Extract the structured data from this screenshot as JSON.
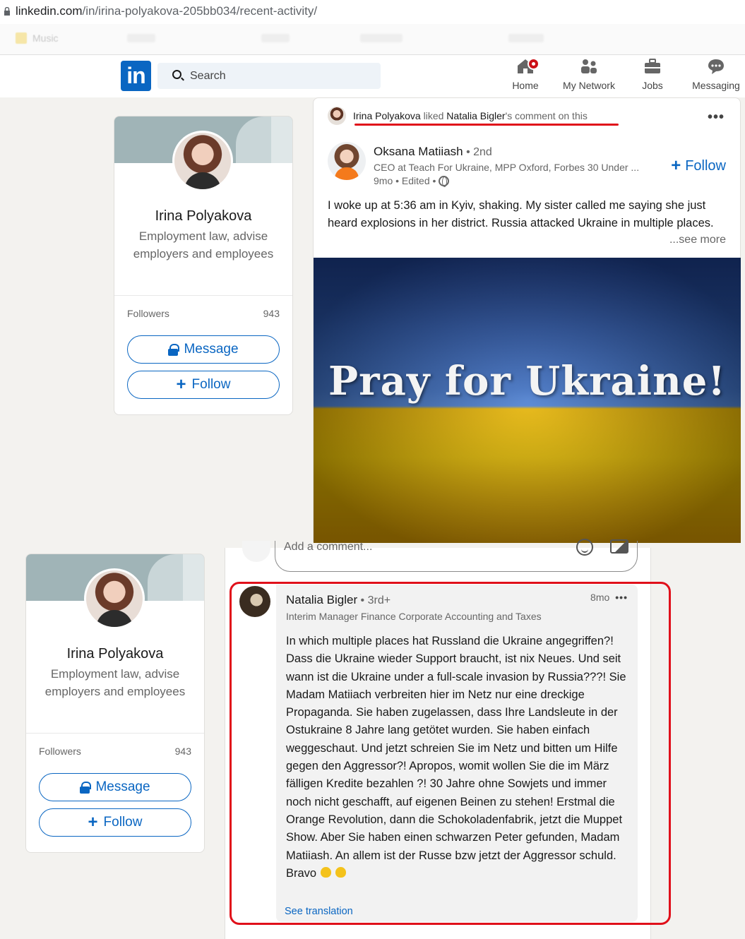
{
  "browser": {
    "url_host": "linkedin.com",
    "url_path": "/in/irina-polyakova-205bb034/recent-activity/",
    "bookmark_label": "Music"
  },
  "nav": {
    "logo_text": "in",
    "search_placeholder": "Search",
    "items": [
      {
        "label": "Home"
      },
      {
        "label": "My Network"
      },
      {
        "label": "Jobs"
      },
      {
        "label": "Messaging"
      }
    ],
    "brand_color": "#0a66c2"
  },
  "profile": {
    "name": "Irina Polyakova",
    "headline": "Employment law, advise employers and employees",
    "followers_label": "Followers",
    "followers_count": "943",
    "message_label": "Message",
    "follow_label": "Follow"
  },
  "post": {
    "context_actor": "Irina Polyakova",
    "context_verb": " liked ",
    "context_target": "Natalia Bigler",
    "context_rest": "'s comment on this",
    "author_name": "Oksana Matiiash",
    "author_degree": " • 2nd",
    "author_subtitle": "CEO at Teach For Ukraine, MPP Oxford, Forbes 30 Under ...",
    "author_time": "9mo • Edited •",
    "follow_label": "Follow",
    "text": "I woke up at 5:36 am in Kyiv, shaking. My sister called me saying she just heard explosions in her district. Russia attacked Ukraine in multiple places.",
    "see_more": "...see more",
    "image_text": "Pray for Ukraine!"
  },
  "comment_box": {
    "placeholder": "Add a comment..."
  },
  "comment": {
    "author_name": "Natalia Bigler",
    "author_degree": " • 3rd+",
    "author_subtitle": "Interim Manager Finance Corporate Accounting and Taxes",
    "time": "8mo",
    "text": "In which multiple places hat Russland die Ukraine angegriffen?! Dass die Ukraine wieder Support braucht, ist nix Neues. Und seit wann ist die Ukraine under a full-scale invasion by Russia???! Sie Madam Matiiach verbreiten hier im Netz nur eine dreckige Propaganda. Sie haben zugelassen, dass Ihre Landsleute in der Ostukraine 8 Jahre lang getötet wurden. Sie haben einfach weggeschaut. Und jetzt schreien Sie im Netz und bitten um Hilfe gegen den Aggressor?! Apropos, womit wollen Sie die im März fälligen Kredite bezahlen ?! 30 Jahre ohne Sowjets und immer noch nicht geschafft, auf eigenen Beinen zu stehen! Erstmal die Orange Revolution, dann die Schokoladenfabrik, jetzt die Muppet Show. Aber Sie haben einen schwarzen Peter gefunden, Madam Matiiash. An allem ist der Russe bzw jetzt der Aggressor schuld. Bravo",
    "see_translation": "See translation"
  },
  "highlight_color": "#e0101a"
}
